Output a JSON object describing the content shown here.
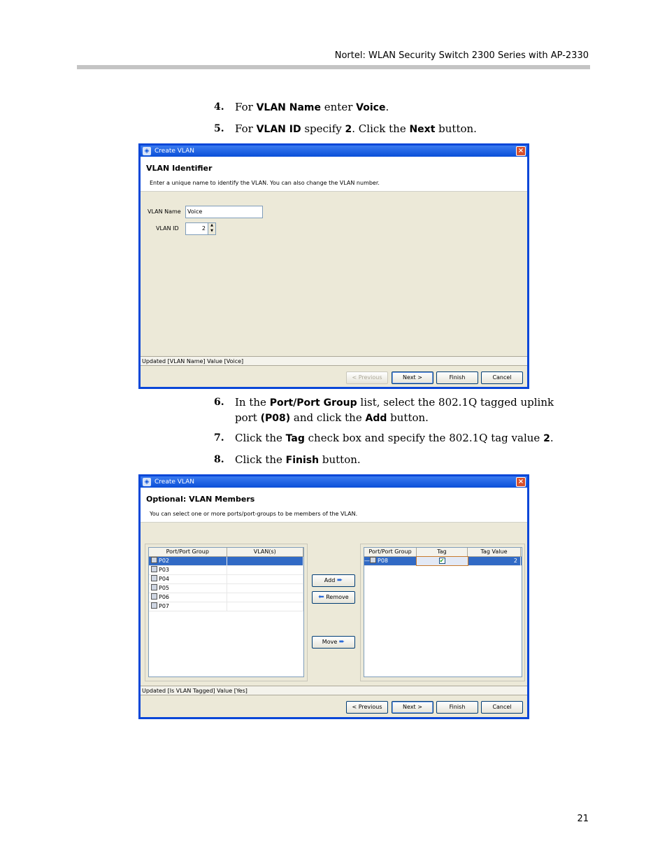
{
  "header": {
    "title": "Nortel: WLAN Security Switch 2300 Series with AP-2330"
  },
  "steps": [
    {
      "num": "4.",
      "parts": [
        "For ",
        "VLAN Name",
        " enter ",
        "Voice",
        "."
      ]
    },
    {
      "num": "5.",
      "parts": [
        "For ",
        "VLAN ID",
        " specify ",
        "2",
        ". Click the ",
        "Next",
        " button."
      ]
    },
    {
      "num": "6.",
      "parts": [
        "In the ",
        "Port/Port Group",
        " list, select the 802.1Q tagged uplink port ",
        "(P08)",
        " and click the ",
        "Add",
        " button."
      ]
    },
    {
      "num": "7.",
      "parts": [
        " Click the ",
        "Tag",
        " check box and specify the 802.1Q tag value ",
        "2",
        "."
      ]
    },
    {
      "num": "8.",
      "parts": [
        "Click the ",
        "Finish",
        " button."
      ]
    }
  ],
  "dialog1": {
    "title": "Create VLAN",
    "heading": "VLAN Identifier",
    "description": "Enter a unique name to identify the VLAN. You can also change the VLAN number.",
    "name_label": "VLAN Name",
    "name_value": "Voice",
    "id_label": "VLAN ID",
    "id_value": "2",
    "status": "Updated [VLAN Name] Value [Voice]",
    "buttons": {
      "previous": "< Previous",
      "next": "Next >",
      "finish": "Finish",
      "cancel": "Cancel"
    }
  },
  "dialog2": {
    "title": "Create VLAN",
    "heading": "Optional: VLAN Members",
    "description": "You can select one or more ports/port-groups to be members of the VLAN.",
    "left_table": {
      "columns": [
        "Port/Port Group",
        "VLAN(s)"
      ],
      "rows": [
        "P02",
        "P03",
        "P04",
        "P05",
        "P06",
        "P07"
      ]
    },
    "right_table": {
      "columns": [
        "Port/Port Group",
        "Tag",
        "Tag Value"
      ],
      "row": {
        "port": "P08",
        "tag_checked": true,
        "tag_value": "2"
      }
    },
    "add_label": "Add",
    "remove_label": "Remove",
    "move_label": "Move",
    "status": "Updated [Is VLAN Tagged] Value [Yes]",
    "buttons": {
      "previous": "< Previous",
      "next": "Next >",
      "finish": "Finish",
      "cancel": "Cancel"
    }
  },
  "page_number": "21"
}
